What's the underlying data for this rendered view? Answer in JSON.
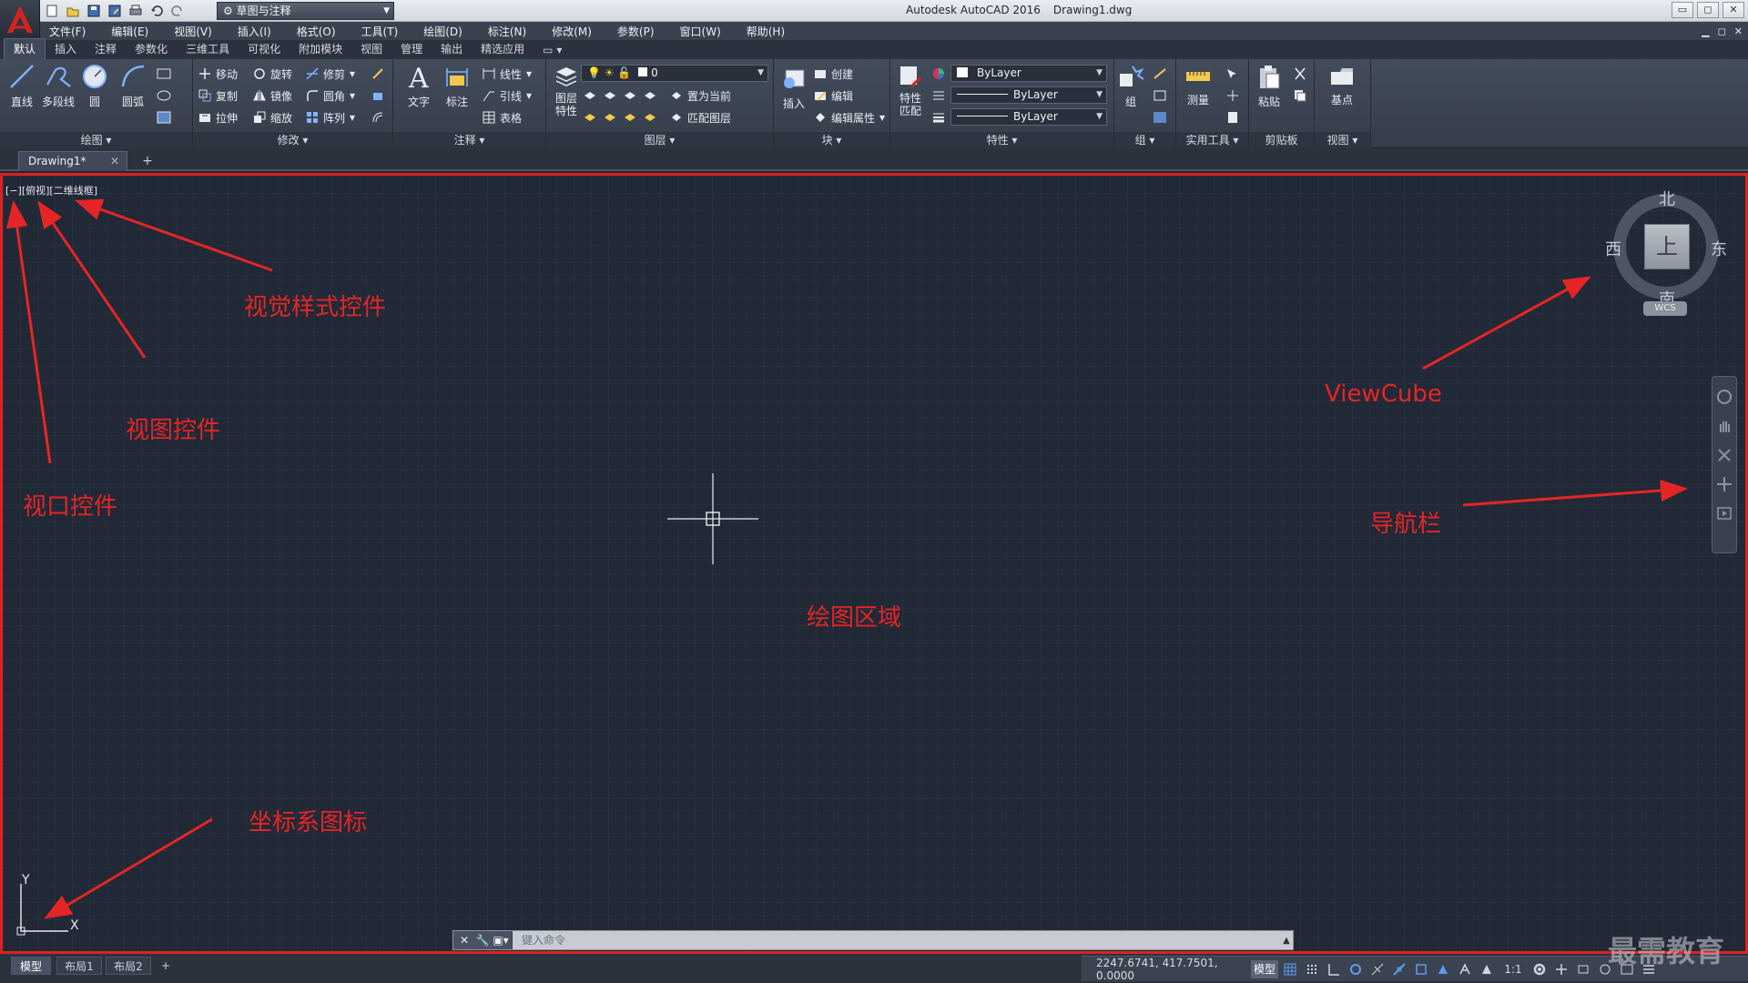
{
  "app": {
    "title": "Autodesk AutoCAD 2016",
    "file": "Drawing1.dwg",
    "workspace": "草图与注释",
    "window_controls": [
      "▭",
      "◻",
      "✕"
    ],
    "mdi_controls": [
      "▁",
      "◻",
      "✕"
    ]
  },
  "menus": [
    "文件(F)",
    "编辑(E)",
    "视图(V)",
    "插入(I)",
    "格式(O)",
    "工具(T)",
    "绘图(D)",
    "标注(N)",
    "修改(M)",
    "参数(P)",
    "窗口(W)",
    "帮助(H)"
  ],
  "ribbon_tabs": [
    "默认",
    "插入",
    "注释",
    "参数化",
    "三维工具",
    "可视化",
    "附加模块",
    "视图",
    "管理",
    "输出",
    "精选应用"
  ],
  "ribbon_panels": {
    "draw": {
      "title": "绘图 ▾",
      "buttons": [
        "直线",
        "多段线",
        "圆",
        "圆弧"
      ]
    },
    "modify": {
      "title": "修改 ▾",
      "rows": [
        "移动",
        "旋转",
        "修剪",
        "复制",
        "镜像",
        "圆角",
        "拉伸",
        "缩放",
        "阵列"
      ]
    },
    "annotation": {
      "title": "注释 ▾",
      "buttons": [
        "文字",
        "标注"
      ],
      "rows": [
        "线性",
        "引线",
        "表格"
      ]
    },
    "layers": {
      "title": "图层 ▾",
      "button": "图层\n特性",
      "current_layer": "0",
      "rows": [
        "置为当前",
        "匹配图层"
      ]
    },
    "block": {
      "title": "块 ▾",
      "button": "插入",
      "rows": [
        "创建",
        "编辑",
        "编辑属性"
      ]
    },
    "properties": {
      "title": "特性 ▾",
      "button": "特性\n匹配",
      "color": "ByLayer",
      "linetype": "ByLayer",
      "lineweight": "ByLayer"
    },
    "groups": {
      "title": "组 ▾",
      "button": "组"
    },
    "utilities": {
      "title": "实用工具 ▾",
      "button": "测量"
    },
    "clipboard": {
      "title": "剪贴板",
      "button": "粘贴"
    },
    "view": {
      "title": "视图 ▾",
      "button": "基点"
    }
  },
  "doc_tab": {
    "name": "Drawing1*",
    "close": "✕",
    "add": "+"
  },
  "viewport_controls": [
    "[−]",
    "[俯视]",
    "[二维线框]"
  ],
  "viewcube": {
    "north": "北",
    "south": "南",
    "east": "东",
    "west": "西",
    "face": "上",
    "wcs": "WCS"
  },
  "ucs": {
    "x": "X",
    "y": "Y"
  },
  "annotations": {
    "visual_style": "视觉样式控件",
    "view_control": "视图控件",
    "viewport_control": "视口控件",
    "viewcube": "ViewCube",
    "navbar": "导航栏",
    "drawing_area": "绘图区域",
    "ucs_icon": "坐标系图标"
  },
  "command_line": {
    "placeholder": "键入命令"
  },
  "layout_tabs": [
    "模型",
    "布局1",
    "布局2",
    "+"
  ],
  "status": {
    "coords": "2247.6741, 417.7501, 0.0000",
    "model": "模型",
    "scale": "1:1"
  },
  "watermark": "最需教育",
  "colors": {
    "accent": "#e02020",
    "background": "#212836",
    "ribbon": "#3b4350"
  }
}
